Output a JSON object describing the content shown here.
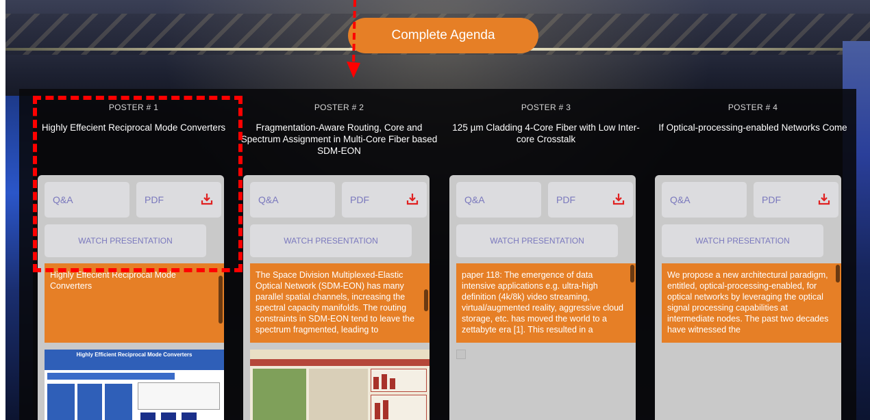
{
  "header": {
    "agenda_label": "Complete Agenda"
  },
  "posters": [
    {
      "number": "POSTER # 1",
      "title": "Highly Effecient Reciprocal Mode Converters",
      "qa_label": "Q&A",
      "pdf_label": "PDF",
      "watch_label": "WATCH PRESENTATION",
      "abstract": "Highly Effecient Reciprocal Mode Converters",
      "thumbnail_title": "Highly Efficient Reciprocal Mode Converters"
    },
    {
      "number": "POSTER # 2",
      "title": "Fragmentation-Aware Routing, Core and Spectrum Assignment in Multi-Core Fiber based SDM-EON",
      "qa_label": "Q&A",
      "pdf_label": "PDF",
      "watch_label": "WATCH PRESENTATION",
      "abstract": "The Space Division Multiplexed-Elastic Optical Network (SDM-EON) has many parallel spatial channels, increasing the spectral capacity manifolds. The routing constraints in SDM-EON tend to leave the spectrum fragmented, leading to"
    },
    {
      "number": "POSTER # 3",
      "title": "125 µm Cladding 4-Core Fiber with Low Inter-core Crosstalk",
      "qa_label": "Q&A",
      "pdf_label": "PDF",
      "watch_label": "WATCH PRESENTATION",
      "abstract": "paper 118: The emergence of data intensive applications e.g. ultra-high definition (4k/8k) video streaming, virtual/augmented reality, aggressive cloud storage, etc. has moved the world to a zettabyte era [1]. This resulted in a"
    },
    {
      "number": "POSTER # 4",
      "title": "If Optical-processing-enabled Networks Come",
      "qa_label": "Q&A",
      "pdf_label": "PDF",
      "watch_label": "WATCH PRESENTATION",
      "abstract": "We propose a new architectural paradigm, entitled, optical-processing-enabled, for optical networks by leveraging the optical signal processing capabilities at intermediate nodes. The past two decades have witnessed the"
    }
  ],
  "colors": {
    "accent": "#e67f26",
    "highlight": "#ff0000",
    "link_text": "#7a78bd"
  },
  "icons": {
    "download": "download-icon"
  }
}
